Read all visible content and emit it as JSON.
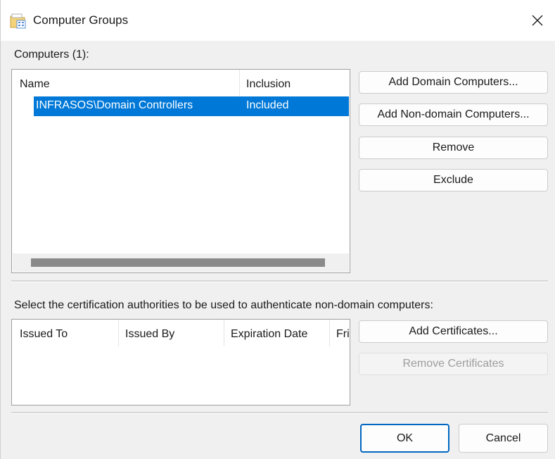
{
  "window": {
    "title": "Computer Groups",
    "icon": "folder-group-icon",
    "close_label": "✕"
  },
  "computers_section": {
    "label": "Computers (1):",
    "columns": [
      "Name",
      "Inclusion"
    ],
    "rows": [
      {
        "name": "INFRASOS\\Domain Controllers",
        "inclusion": "Included",
        "selected": true
      }
    ]
  },
  "computer_buttons": {
    "add_domain": "Add Domain Computers...",
    "add_non_domain": "Add Non-domain Computers...",
    "remove": "Remove",
    "exclude": "Exclude"
  },
  "certs_section": {
    "label": "Select the certification authorities to be used to authenticate non-domain computers:",
    "columns": [
      "Issued To",
      "Issued By",
      "Expiration Date",
      "Fri"
    ]
  },
  "cert_buttons": {
    "add": "Add Certificates...",
    "remove": "Remove Certificates"
  },
  "footer": {
    "ok": "OK",
    "cancel": "Cancel"
  },
  "colors": {
    "selection": "#0078d7",
    "default_button_border": "#0067c0"
  }
}
